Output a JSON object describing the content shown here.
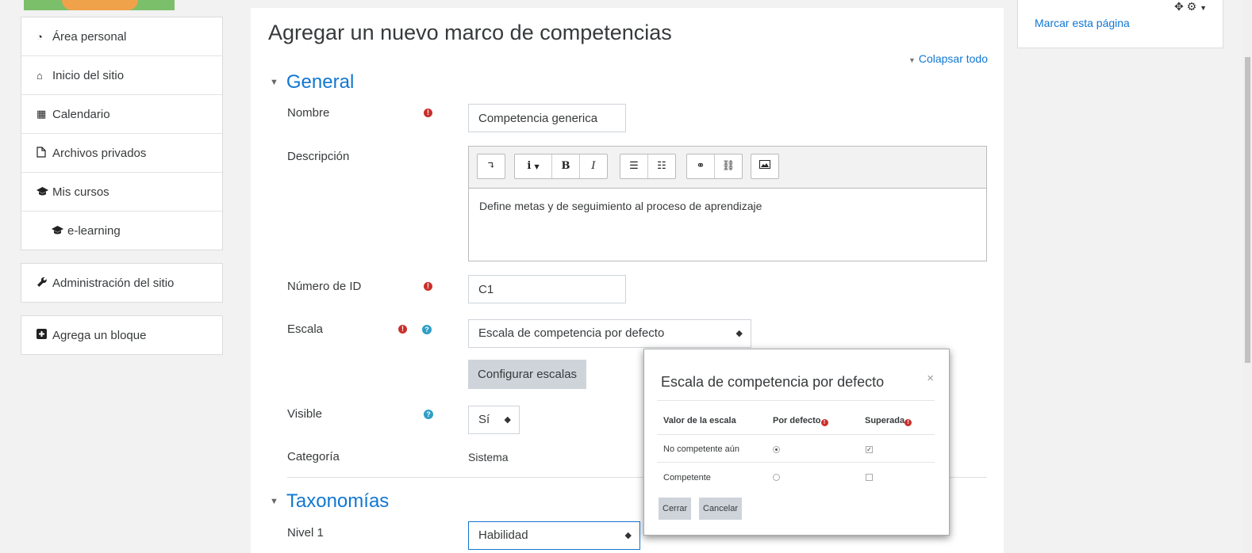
{
  "colors": {
    "accent": "#1177d1",
    "required": "#c9302c",
    "help": "#2f9ec7",
    "button_grey": "#ced4da"
  },
  "sidebar": {
    "items": [
      {
        "label": "Área personal",
        "icon": "dashboard-icon"
      },
      {
        "label": "Inicio del sitio",
        "icon": "home-icon"
      },
      {
        "label": "Calendario",
        "icon": "calendar-icon"
      },
      {
        "label": "Archivos privados",
        "icon": "file-icon"
      },
      {
        "label": "Mis cursos",
        "icon": "graduation-cap-icon"
      },
      {
        "label": "e-learning",
        "icon": "graduation-cap-icon"
      }
    ],
    "admin": {
      "label": "Administración del sitio",
      "icon": "wrench-icon"
    },
    "add_block": {
      "label": "Agrega un bloque",
      "icon": "plus-square-icon"
    }
  },
  "main": {
    "title": "Agregar un nuevo marco de competencias",
    "collapse_all": "Colapsar todo",
    "section_general": "General",
    "section_taxonomies": "Taxonomías",
    "fields": {
      "name_label": "Nombre",
      "name_value": "Competencia generica",
      "description_label": "Descripción",
      "description_value": "Define metas y de seguimiento al proceso de aprendizaje",
      "idnumber_label": "Número de ID",
      "idnumber_value": "C1",
      "scale_label": "Escala",
      "scale_value": "Escala de competencia por defecto",
      "configure_scales": "Configurar escalas",
      "visible_label": "Visible",
      "visible_value": "Sí",
      "category_label": "Categoría",
      "category_value": "Sistema",
      "level1_label": "Nivel 1",
      "level1_value": "Habilidad"
    },
    "toolbar": {
      "bold": "B",
      "italic": "I",
      "info": "i"
    }
  },
  "right_block": {
    "bookmark": "Marcar esta página"
  },
  "modal": {
    "title": "Escala de competencia por defecto",
    "close": "×",
    "col_scale": "Valor de la escala",
    "col_default": "Por defecto",
    "col_proficient": "Superada",
    "rows": [
      {
        "label": "No competente aún",
        "default": true,
        "proficient": true
      },
      {
        "label": "Competente",
        "default": false,
        "proficient": false
      }
    ],
    "close_button": "Cerrar",
    "cancel_button": "Cancelar"
  }
}
